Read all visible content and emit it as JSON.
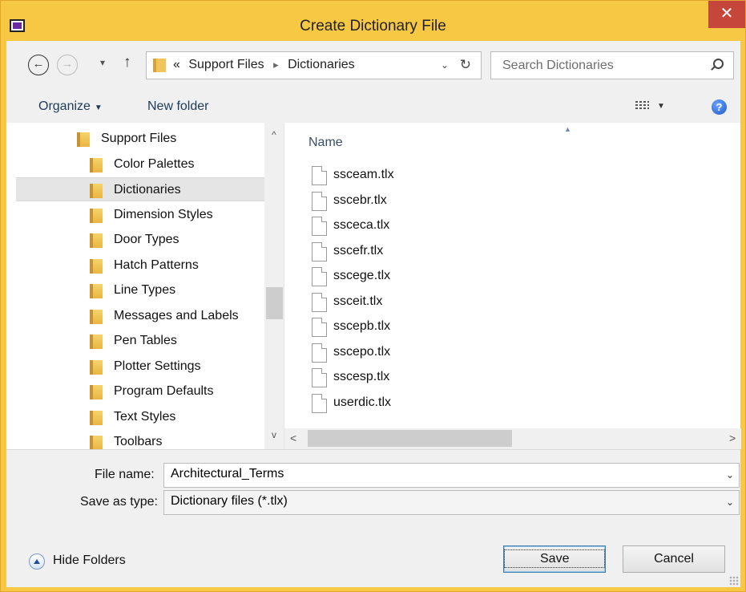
{
  "window": {
    "title": "Create Dictionary File",
    "close_glyph": "✕"
  },
  "nav": {
    "back_glyph": "←",
    "forward_glyph": "→",
    "recent_glyph": "▾",
    "up_glyph": "↑",
    "breadcrumb_prefix": "«",
    "breadcrumb": [
      "Support Files",
      "Dictionaries"
    ],
    "breadcrumb_sep": "▸",
    "address_dropdown_glyph": "⌄",
    "refresh_glyph": "↻",
    "search_placeholder": "Search Dictionaries"
  },
  "commands": {
    "organize": "Organize",
    "organize_arrow": "▼",
    "new_folder": "New folder",
    "view_dropdown": "▼",
    "help": "?"
  },
  "tree": {
    "items": [
      {
        "label": "Support Files",
        "level": 0,
        "selected": false
      },
      {
        "label": "Color Palettes",
        "level": 1,
        "selected": false
      },
      {
        "label": "Dictionaries",
        "level": 1,
        "selected": true
      },
      {
        "label": "Dimension Styles",
        "level": 1,
        "selected": false
      },
      {
        "label": "Door Types",
        "level": 1,
        "selected": false
      },
      {
        "label": "Hatch Patterns",
        "level": 1,
        "selected": false
      },
      {
        "label": "Line Types",
        "level": 1,
        "selected": false
      },
      {
        "label": "Messages and Labels",
        "level": 1,
        "selected": false
      },
      {
        "label": "Pen Tables",
        "level": 1,
        "selected": false
      },
      {
        "label": "Plotter Settings",
        "level": 1,
        "selected": false
      },
      {
        "label": "Program Defaults",
        "level": 1,
        "selected": false
      },
      {
        "label": "Text Styles",
        "level": 1,
        "selected": false
      },
      {
        "label": "Toolbars",
        "level": 1,
        "selected": false
      }
    ],
    "scroll_up": "^",
    "scroll_down": "v"
  },
  "files": {
    "column_name": "Name",
    "sort_glyph": "▲",
    "items": [
      "ssceam.tlx",
      "sscebr.tlx",
      "ssceca.tlx",
      "sscefr.tlx",
      "sscege.tlx",
      "ssceit.tlx",
      "sscepb.tlx",
      "sscepo.tlx",
      "sscesp.tlx",
      "userdic.tlx"
    ],
    "scroll_left": "<",
    "scroll_right": ">"
  },
  "form": {
    "file_name_label": "File name:",
    "file_name_value": "Architectural_Terms",
    "save_type_label": "Save as type:",
    "save_type_value": "Dictionary files (*.tlx)",
    "dropdown_glyph": "⌄"
  },
  "footer": {
    "hide_folders": "Hide Folders",
    "save": "Save",
    "cancel": "Cancel"
  }
}
